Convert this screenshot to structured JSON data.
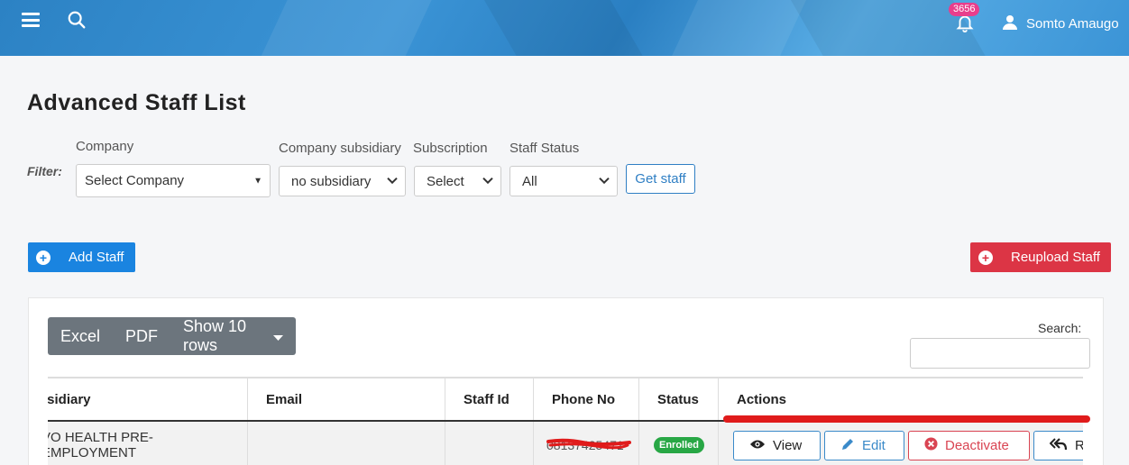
{
  "header": {
    "notification_count": "3656",
    "user_name": "Somto Amaugo"
  },
  "page": {
    "title": "Advanced Staff List"
  },
  "filters": {
    "label": "Filter:",
    "company": {
      "label": "Company",
      "value": "Select Company"
    },
    "subsidiary": {
      "label": "Company subsidiary",
      "value": "no subsidiary"
    },
    "subscription": {
      "label": "Subscription",
      "value": "Select"
    },
    "staff_status": {
      "label": "Staff Status",
      "value": "All"
    },
    "get_staff_label": "Get staff"
  },
  "actions": {
    "add_staff": "Add Staff",
    "reupload_staff": "Reupload Staff"
  },
  "table_tools": {
    "excel": "Excel",
    "pdf": "PDF",
    "show_rows": "Show 10 rows",
    "search_label": "Search:"
  },
  "table": {
    "columns": [
      "osidiary",
      "Email",
      "Staff Id",
      "Phone No",
      "Status",
      "Actions"
    ],
    "rows": [
      {
        "subsidiary": "VO HEALTH PRE-EMPLOYMENT",
        "email": "",
        "staff_id": "",
        "phone": "08137425471",
        "status": "Enrolled",
        "view": "View",
        "edit": "Edit",
        "deactivate": "Deactivate",
        "r": "R"
      }
    ]
  },
  "colors": {
    "primary": "#1a84e0",
    "danger": "#dc3545",
    "success": "#28a745",
    "secondary": "#6c757d",
    "badge": "#e83e8c"
  }
}
